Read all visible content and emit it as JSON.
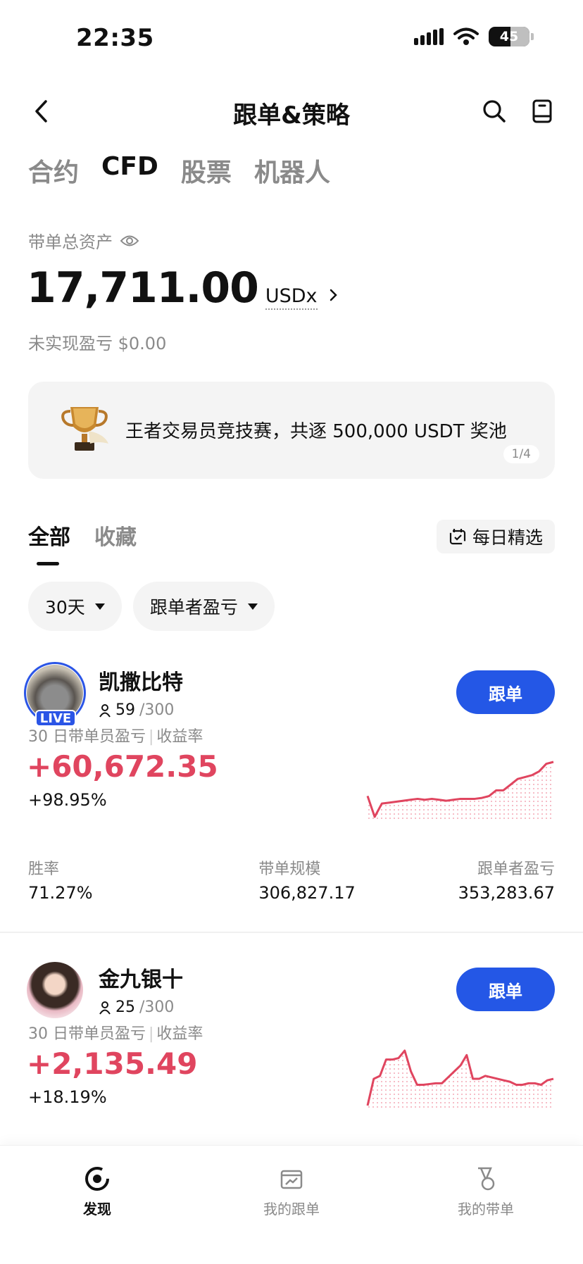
{
  "status_bar": {
    "time": "22:35",
    "battery": "45"
  },
  "nav": {
    "title": "跟单&策略"
  },
  "category_tabs": [
    {
      "label": "合约",
      "active": false
    },
    {
      "label": "CFD",
      "active": true
    },
    {
      "label": "股票",
      "active": false
    },
    {
      "label": "机器人",
      "active": false
    }
  ],
  "assets": {
    "label": "带单总资产",
    "value": "17,711.00",
    "unit": "USDx",
    "unrealized": "未实现盈亏 $0.00"
  },
  "banner": {
    "text": "王者交易员竞技赛，共逐 500,000 USDT 奖池",
    "pager": "1/4"
  },
  "list_tabs": {
    "all": "全部",
    "favorites": "收藏",
    "daily_pick": "每日精选"
  },
  "filters": {
    "period": "30天",
    "sort": "跟单者盈亏"
  },
  "traders": [
    {
      "name": "凯撒比特",
      "live": "LIVE",
      "followers": "59",
      "followers_max": "/300",
      "follow_label": "跟单",
      "pnl_label": "30 日带单员盈亏",
      "rate_label": "收益率",
      "pnl": "+60,672.35",
      "rate": "+98.95%",
      "win_rate_label": "胜率",
      "win_rate": "71.27%",
      "scale_label": "带单规模",
      "scale": "306,827.17",
      "follower_pnl_label": "跟单者盈亏",
      "follower_pnl": "353,283.67",
      "sparkline": [
        30,
        8,
        22,
        23,
        24,
        25,
        26,
        27,
        26,
        27,
        26,
        25,
        26,
        27,
        27,
        27,
        28,
        30,
        36,
        36,
        42,
        48,
        50,
        52,
        56,
        64,
        66
      ]
    },
    {
      "name": "金九银十",
      "followers": "25",
      "followers_max": "/300",
      "follow_label": "跟单",
      "pnl_label": "30 日带单员盈亏",
      "rate_label": "收益率",
      "pnl": "+2,135.49",
      "rate": "+18.19%",
      "sparkline": [
        4,
        40,
        44,
        66,
        66,
        68,
        78,
        50,
        32,
        32,
        33,
        34,
        34,
        42,
        50,
        58,
        72,
        40,
        40,
        44,
        42,
        40,
        38,
        36,
        32,
        32,
        34,
        34,
        32,
        38,
        40
      ]
    }
  ],
  "bottom_nav": [
    {
      "label": "发现",
      "icon": "discover-icon",
      "active": true
    },
    {
      "label": "我的跟单",
      "icon": "my-copy-icon",
      "active": false
    },
    {
      "label": "我的带单",
      "icon": "my-lead-icon",
      "active": false
    }
  ],
  "colors": {
    "accent": "#2457e6",
    "profit": "#e0455f",
    "muted": "#8a8a8a"
  }
}
